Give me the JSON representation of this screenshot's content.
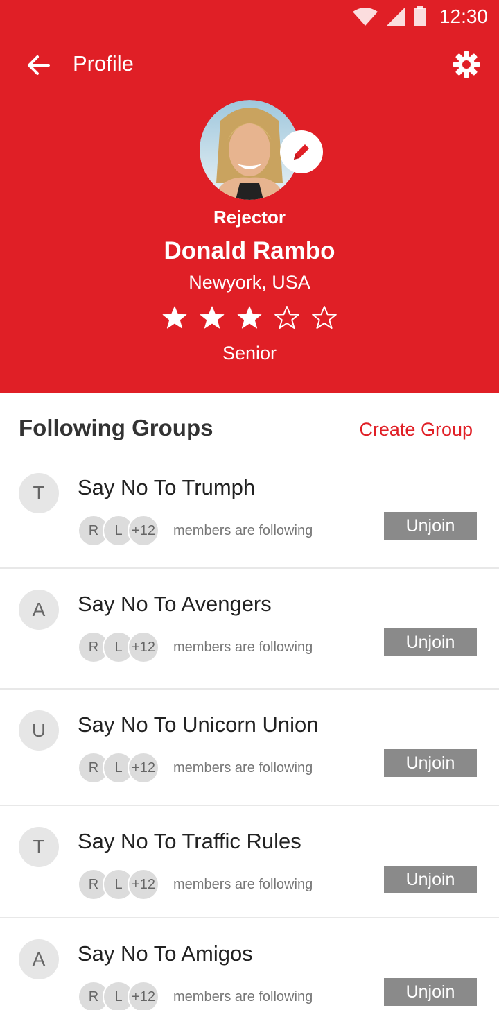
{
  "status_bar": {
    "time": "12:30"
  },
  "app_bar": {
    "title": "Profile"
  },
  "profile": {
    "role": "Rejector",
    "name": "Donald Rambo",
    "location": "Newyork, USA",
    "rating": 3,
    "rating_max": 5,
    "level": "Senior"
  },
  "section": {
    "title": "Following Groups",
    "action": "Create Group"
  },
  "groups": [
    {
      "initial": "T",
      "name": "Say No To Trumph",
      "members": [
        "R",
        "L",
        "+12"
      ],
      "members_text": "members are following",
      "button": "Unjoin"
    },
    {
      "initial": "A",
      "name": "Say No To Avengers",
      "members": [
        "R",
        "L",
        "+12"
      ],
      "members_text": "members are following",
      "button": "Unjoin"
    },
    {
      "initial": "U",
      "name": "Say No To Unicorn Union",
      "members": [
        "R",
        "L",
        "+12"
      ],
      "members_text": "members are following",
      "button": "Unjoin"
    },
    {
      "initial": "T",
      "name": "Say No To Traffic Rules",
      "members": [
        "R",
        "L",
        "+12"
      ],
      "members_text": "members are following",
      "button": "Unjoin"
    },
    {
      "initial": "A",
      "name": "Say No To Amigos",
      "members": [
        "R",
        "L",
        "+12"
      ],
      "members_text": "members are following",
      "button": "Unjoin"
    }
  ],
  "colors": {
    "accent": "#e01f26",
    "button": "#8a8a8a"
  },
  "icons": {
    "back": "arrow-left-icon",
    "settings": "gear-icon",
    "edit": "pencil-icon",
    "star": "star-icon"
  }
}
